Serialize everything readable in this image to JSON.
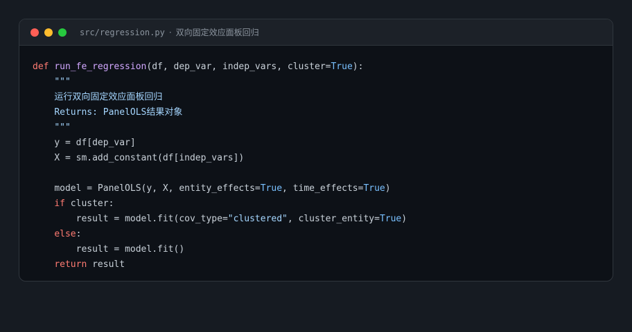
{
  "window": {
    "file_path": "src/regression.py",
    "separator": "·",
    "description": "双向固定效应面板回归"
  },
  "colors": {
    "keyword": "#ff7b72",
    "function": "#d2a8ff",
    "boolean": "#79c0ff",
    "string": "#a5d6ff",
    "text": "#c9d1d9",
    "background": "#0d1117"
  },
  "code": {
    "l1_def": "def",
    "l1_fn": "run_fe_regression",
    "l1_args": "(df, dep_var, indep_vars, cluster=",
    "l1_true": "True",
    "l1_end": "):",
    "l2_doc_open": "\"\"\"",
    "l3_doc_text": "运行双向固定效应面板回归",
    "l4_doc_returns": "Returns: PanelOLS结果对象",
    "l5_doc_close": "\"\"\"",
    "l6": "y = df[dep_var]",
    "l7": "X = sm.add_constant(df[indep_vars])",
    "l9_a": "model = PanelOLS(y, X, entity_effects=",
    "l9_true1": "True",
    "l9_b": ", time_effects=",
    "l9_true2": "True",
    "l9_end": ")",
    "l10_if": "if",
    "l10_rest": " cluster:",
    "l11_a": "result = model.fit(cov_type=",
    "l11_str": "\"clustered\"",
    "l11_b": ", cluster_entity=",
    "l11_true": "True",
    "l11_end": ")",
    "l12_else": "else",
    "l12_colon": ":",
    "l13": "result = model.fit()",
    "l14_return": "return",
    "l14_rest": " result"
  }
}
